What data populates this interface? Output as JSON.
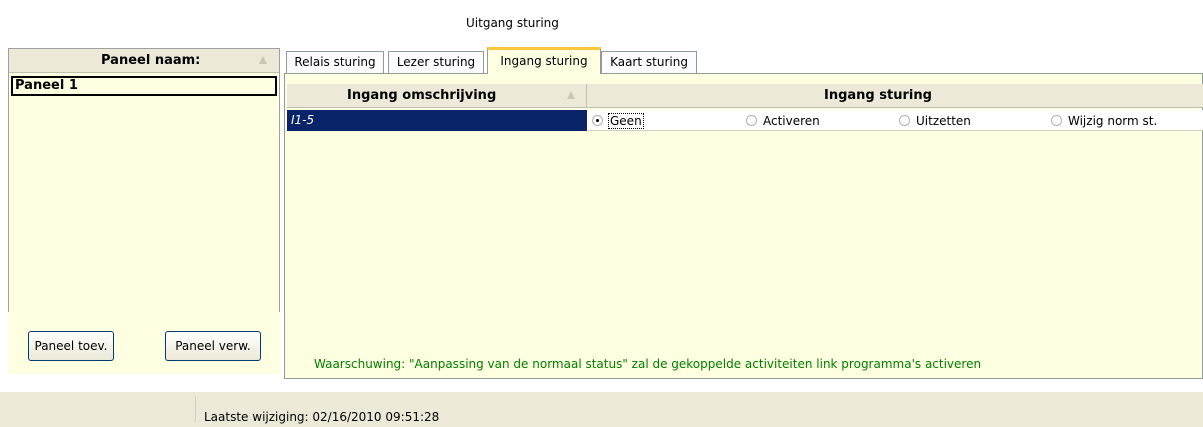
{
  "window": {
    "title": "Uitgang sturing"
  },
  "left_panel": {
    "header": "Paneel naam:",
    "rows": [
      "Paneel 1"
    ],
    "buttons": {
      "add": "Paneel toev.",
      "remove": "Paneel verw."
    }
  },
  "tabs": [
    {
      "label": "Relais sturing",
      "active": false
    },
    {
      "label": "Lezer sturing",
      "active": false
    },
    {
      "label": "Ingang sturing",
      "active": true
    },
    {
      "label": "Kaart sturing",
      "active": false
    }
  ],
  "grid": {
    "columns": [
      "Ingang omschrijving",
      "Ingang sturing"
    ],
    "rows": [
      {
        "description": "I1-5",
        "selected_option": "Geen"
      }
    ],
    "options": [
      "Geen",
      "Activeren",
      "Uitzetten",
      "Wijzig norm st."
    ]
  },
  "warning": "Waarschuwing: \"Aanpassing van de normaal status\" zal de gekoppelde activiteiten link programma's activeren",
  "status_bar": {
    "text": "Laatste wijziging: 02/16/2010 09:51:28"
  },
  "colors": {
    "panel_bg": "#ffffe1",
    "selection": "#0a246a",
    "warning": "#008000",
    "active_tab_accent": "#ffc83c"
  }
}
